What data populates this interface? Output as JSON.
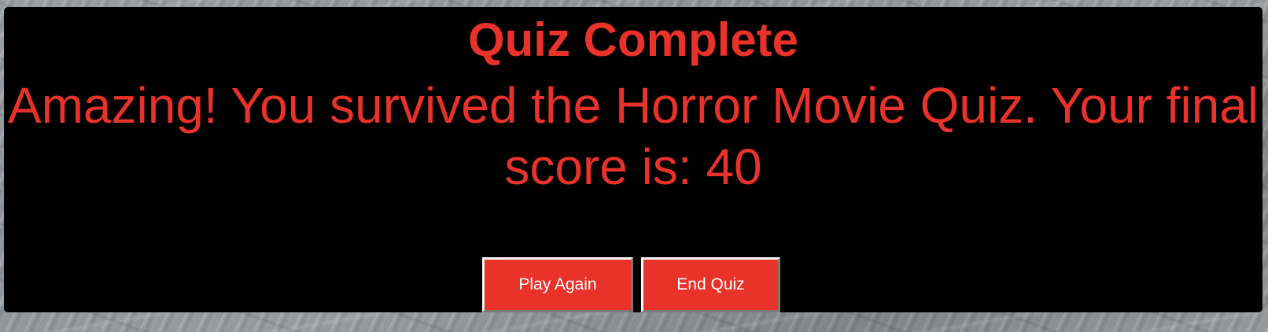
{
  "quiz": {
    "heading": "Quiz Complete",
    "result_message": "Amazing! You survived the Horror Movie Quiz. Your final score is: 40",
    "final_score": 40
  },
  "buttons": {
    "play_again_label": "Play Again",
    "end_quiz_label": "End Quiz"
  },
  "colors": {
    "panel_background": "#000000",
    "accent_red": "#e8322a",
    "button_text": "#ffffff",
    "page_background": "#8b9196"
  }
}
